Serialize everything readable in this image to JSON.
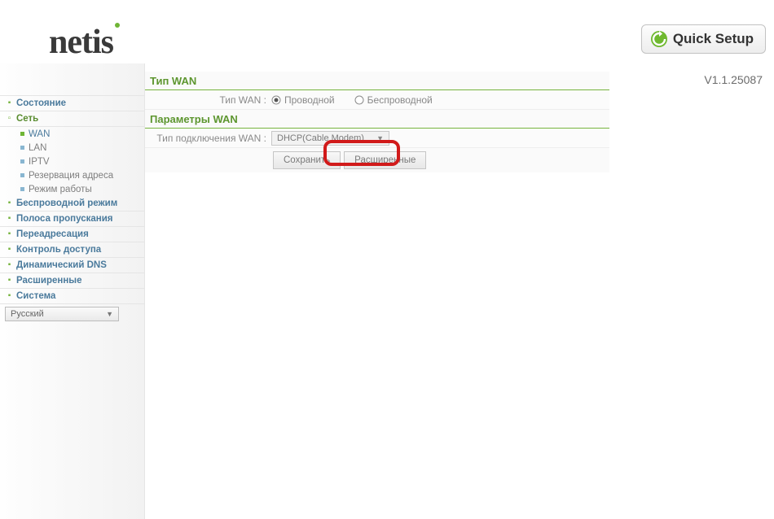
{
  "brand": "netis",
  "quick_setup_label": "Quick Setup",
  "version": "V1.1.25087",
  "sidebar": {
    "items": [
      {
        "label": "Состояние",
        "type": "cat"
      },
      {
        "label": "Сеть",
        "type": "cat-open"
      },
      {
        "label": "WAN",
        "type": "sub-sel"
      },
      {
        "label": "LAN",
        "type": "sub"
      },
      {
        "label": "IPTV",
        "type": "sub"
      },
      {
        "label": "Резервация адреса",
        "type": "sub"
      },
      {
        "label": "Режим работы",
        "type": "sub"
      },
      {
        "label": "Беспроводной режим",
        "type": "cat"
      },
      {
        "label": "Полоса пропускания",
        "type": "cat"
      },
      {
        "label": "Переадресация",
        "type": "cat"
      },
      {
        "label": "Контроль доступа",
        "type": "cat"
      },
      {
        "label": "Динамический DNS",
        "type": "cat"
      },
      {
        "label": "Расширенные",
        "type": "cat"
      },
      {
        "label": "Система",
        "type": "cat"
      }
    ],
    "language": "Русский"
  },
  "content": {
    "sec1_head": "Тип WAN",
    "wan_type_label": "Тип WAN :",
    "wan_type_wired": "Проводной",
    "wan_type_wireless": "Беспроводной",
    "sec2_head": "Параметры WAN",
    "conn_type_label": "Тип подключения WAN :",
    "conn_type_value": "DHCP(Cable Modem)",
    "save_btn": "Сохранить",
    "advanced_btn": "Расширенные"
  }
}
